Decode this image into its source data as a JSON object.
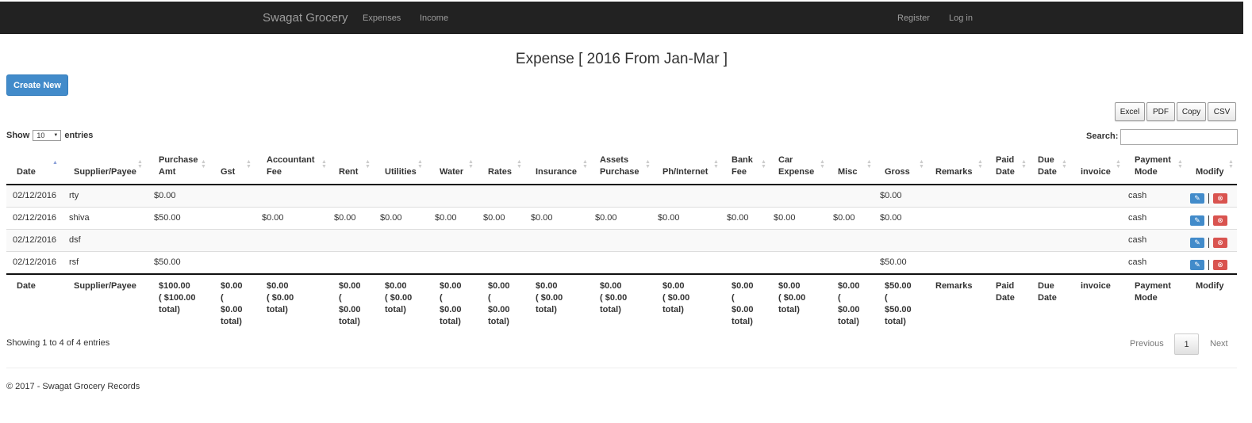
{
  "navbar": {
    "brand": "Swagat Grocery",
    "links": [
      "Expenses",
      "Income"
    ],
    "right_links": [
      "Register",
      "Log in"
    ]
  },
  "page": {
    "title": "Expense [ 2016 From Jan-Mar ]",
    "create_button": "Create New"
  },
  "export_buttons": [
    "Excel",
    "PDF",
    "Copy",
    "CSV"
  ],
  "length_menu": {
    "prefix": "Show",
    "selected": "10",
    "suffix": "entries"
  },
  "search": {
    "label": "Search:",
    "value": ""
  },
  "table": {
    "columns": [
      [
        "Date"
      ],
      [
        "Supplier/Payee"
      ],
      [
        "Purchase",
        "Amt"
      ],
      [
        "Gst"
      ],
      [
        "Accountant",
        "Fee"
      ],
      [
        "Rent"
      ],
      [
        "Utilities"
      ],
      [
        "Water"
      ],
      [
        "Rates"
      ],
      [
        "Insurance"
      ],
      [
        "Assets",
        "Purchase"
      ],
      [
        "Ph/Internet"
      ],
      [
        "Bank",
        "Fee"
      ],
      [
        "Car",
        "Expense"
      ],
      [
        "Misc"
      ],
      [
        "Gross"
      ],
      [
        "Remarks"
      ],
      [
        "Paid",
        "Date"
      ],
      [
        "Due",
        "Date"
      ],
      [
        "invoice"
      ],
      [
        "Payment",
        "Mode"
      ],
      [
        "Modify"
      ]
    ],
    "sorted_column": "Date",
    "rows": [
      [
        "02/12/2016",
        "rty",
        "$0.00",
        "",
        "",
        "",
        "",
        "",
        "",
        "",
        "",
        "",
        "",
        "",
        "",
        "$0.00",
        "",
        "",
        "",
        "",
        "cash"
      ],
      [
        "02/12/2016",
        "shiva",
        "$50.00",
        "",
        "$0.00",
        "$0.00",
        "$0.00",
        "$0.00",
        "$0.00",
        "$0.00",
        "$0.00",
        "$0.00",
        "$0.00",
        "$0.00",
        "$0.00",
        "$0.00",
        "",
        "",
        "",
        "",
        "cash"
      ],
      [
        "02/12/2016",
        "dsf",
        "",
        "",
        "",
        "",
        "",
        "",
        "",
        "",
        "",
        "",
        "",
        "",
        "",
        "",
        "",
        "",
        "",
        "",
        "cash"
      ],
      [
        "02/12/2016",
        "rsf",
        "$50.00",
        "",
        "",
        "",
        "",
        "",
        "",
        "",
        "",
        "",
        "",
        "",
        "",
        "$50.00",
        "",
        "",
        "",
        "",
        "cash"
      ]
    ],
    "footer": [
      [
        "Date"
      ],
      [
        "Supplier/Payee"
      ],
      [
        "$100.00",
        "( $100.00",
        "total)"
      ],
      [
        "$0.00",
        "(",
        "$0.00",
        "total)"
      ],
      [
        "$0.00",
        "( $0.00",
        "total)"
      ],
      [
        "$0.00",
        "(",
        "$0.00",
        "total)"
      ],
      [
        "$0.00",
        "( $0.00",
        "total)"
      ],
      [
        "$0.00",
        "(",
        "$0.00",
        "total)"
      ],
      [
        "$0.00",
        "(",
        "$0.00",
        "total)"
      ],
      [
        "$0.00",
        "( $0.00",
        "total)"
      ],
      [
        "$0.00",
        "( $0.00",
        "total)"
      ],
      [
        "$0.00",
        "( $0.00",
        "total)"
      ],
      [
        "$0.00",
        "(",
        "$0.00",
        "total)"
      ],
      [
        "$0.00",
        "( $0.00",
        "total)"
      ],
      [
        "$0.00",
        "(",
        "$0.00",
        "total)"
      ],
      [
        "$50.00",
        "(",
        "$50.00",
        "total)"
      ],
      [
        "Remarks"
      ],
      [
        "Paid",
        "Date"
      ],
      [
        "Due",
        "Date"
      ],
      [
        "invoice"
      ],
      [
        "Payment",
        "Mode"
      ],
      [
        "Modify"
      ]
    ]
  },
  "info_text": "Showing 1 to 4 of 4 entries",
  "pagination": {
    "previous": "Previous",
    "current": "1",
    "next": "Next"
  },
  "footer_text": "© 2017 - Swagat Grocery Records",
  "icons": {
    "edit": "edit-icon",
    "delete": "delete-icon"
  },
  "colors": {
    "navbar": "#222222",
    "primary": "#428bca",
    "danger": "#d9534f"
  }
}
